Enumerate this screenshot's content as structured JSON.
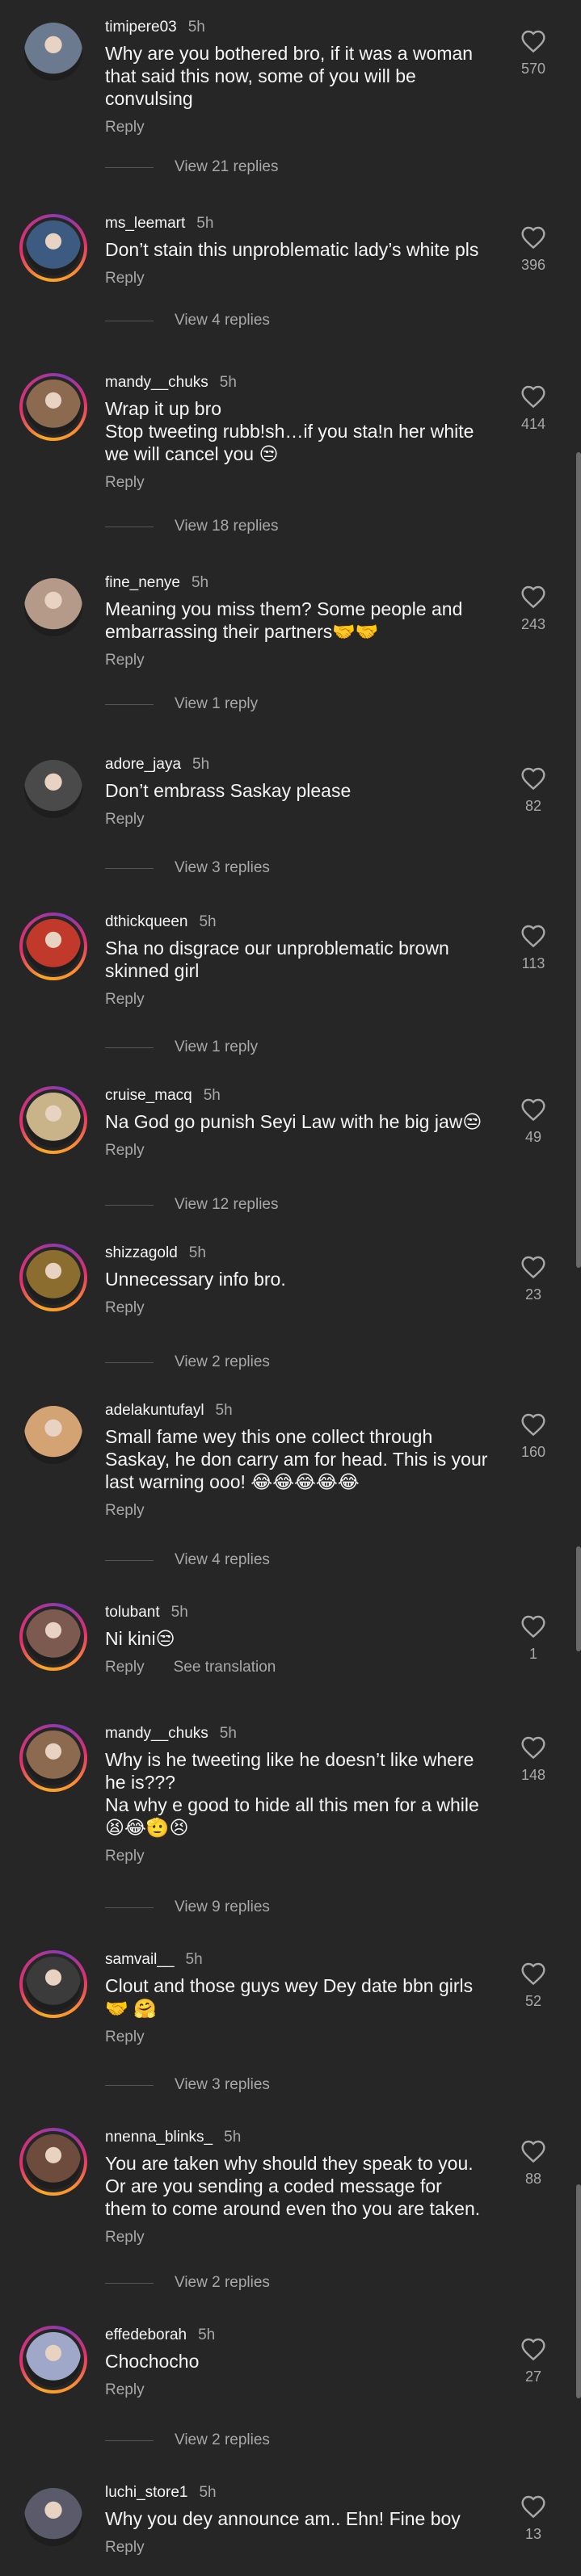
{
  "ui": {
    "reply_label": "Reply",
    "see_translation_label": "See translation"
  },
  "comments": [
    {
      "user": "timipere03",
      "time": "5h",
      "text": "Why are you bothered bro, if it was a woman\nthat said this now, some of you will be\nconvulsing",
      "likes": "570",
      "replies": "View 21 replies",
      "ring": false,
      "avatar_color": "#6b7a8f"
    },
    {
      "user": "ms_leemart",
      "time": "5h",
      "text": "Don’t stain this unproblematic lady’s white pls",
      "likes": "396",
      "replies": "View 4 replies",
      "ring": true,
      "avatar_color": "#3d5a80"
    },
    {
      "user": "mandy__chuks",
      "time": "5h",
      "text": "Wrap it up bro\nStop tweeting rubb!sh…if you sta!n her white\nwe will cancel you 😒",
      "likes": "414",
      "replies": "View 18 replies",
      "ring": true,
      "avatar_color": "#8c6a4f"
    },
    {
      "user": "fine_nenye",
      "time": "5h",
      "text": "Meaning you miss them? Some people and\nembarrassing their partners🤝🤝",
      "likes": "243",
      "replies": "View 1 reply",
      "ring": false,
      "avatar_color": "#b59a8a"
    },
    {
      "user": "adore_jaya",
      "time": "5h",
      "text": "Don’t embrass Saskay please",
      "likes": "82",
      "replies": "View 3 replies",
      "ring": false,
      "avatar_color": "#4a4a4a"
    },
    {
      "user": "dthickqueen",
      "time": "5h",
      "text": "Sha no disgrace our unproblematic brown\nskinned girl",
      "likes": "113",
      "replies": "View 1 reply",
      "ring": true,
      "avatar_color": "#c0392b"
    },
    {
      "user": "cruise_macq",
      "time": "5h",
      "text": "Na God go punish Seyi Law with he big jaw😒",
      "likes": "49",
      "replies": "View 12 replies",
      "ring": true,
      "avatar_color": "#c9b48a"
    },
    {
      "user": "shizzagold",
      "time": "5h",
      "text": "Unnecessary info bro.",
      "likes": "23",
      "replies": "View 2 replies",
      "ring": true,
      "avatar_color": "#8a6d2f"
    },
    {
      "user": "adelakuntufayl",
      "time": "5h",
      "text": "Small fame wey this one collect through\nSaskay, he don carry am for head. This is your\nlast warning ooo! 😂😂😂😂😂",
      "likes": "160",
      "replies": "View 4 replies",
      "ring": false,
      "avatar_color": "#d4a373"
    },
    {
      "user": "tolubant",
      "time": "5h",
      "text": "Ni kini😒",
      "likes": "1",
      "replies": "",
      "ring": true,
      "avatar_color": "#7d5a50",
      "translate": true
    },
    {
      "user": "mandy__chuks",
      "time": "5h",
      "text": "Why is he tweeting like he doesn’t like where\nhe is???\nNa why e good to hide all this men for a while\n😫😂🫡😣",
      "likes": "148",
      "replies": "View 9 replies",
      "ring": true,
      "avatar_color": "#8c6a4f"
    },
    {
      "user": "samvail__",
      "time": "5h",
      "text": "Clout and those guys wey Dey date bbn girls\n🤝 🤗",
      "likes": "52",
      "replies": "View 3 replies",
      "ring": true,
      "avatar_color": "#3b3b3b"
    },
    {
      "user": "nnenna_blinks_",
      "time": "5h",
      "text": "You are taken why should they speak to you.\nOr are you sending a coded message for\nthem to come around even tho you are taken.",
      "likes": "88",
      "replies": "View 2 replies",
      "ring": true,
      "avatar_color": "#6d4c3d"
    },
    {
      "user": "effedeborah",
      "time": "5h",
      "text": "Chochocho",
      "likes": "27",
      "replies": "View 2 replies",
      "ring": true,
      "avatar_color": "#9fa8c9"
    },
    {
      "user": "luchi_store1",
      "time": "5h",
      "text": "Why you dey announce am.. Ehn! Fine boy",
      "likes": "13",
      "replies": "",
      "ring": false,
      "avatar_color": "#5a5a6a"
    }
  ]
}
